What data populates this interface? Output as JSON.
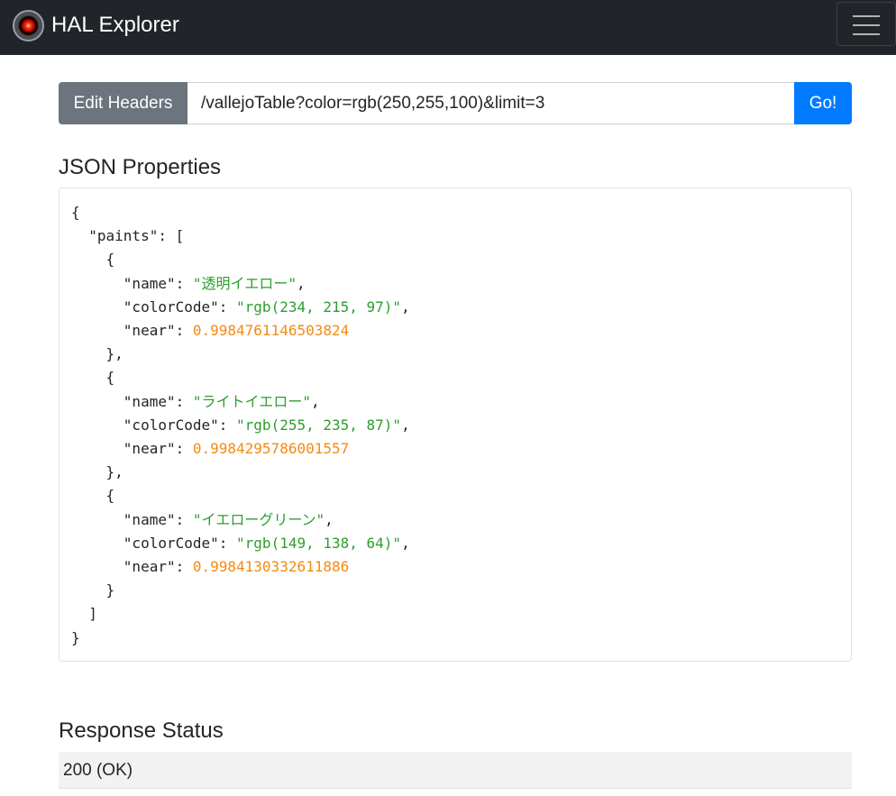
{
  "navbar": {
    "brand": "HAL Explorer",
    "logo_icon": "hal-eye-icon",
    "menu_icon": "hamburger-menu-icon"
  },
  "request": {
    "edit_headers_label": "Edit Headers",
    "uri_value": "/vallejoTable?color=rgb(250,255,100)&limit=3",
    "go_label": "Go!"
  },
  "json_section": {
    "title": "JSON Properties",
    "array_key": "\"paints\"",
    "items": [
      {
        "name": "\"透明イエロー\"",
        "colorCode": "\"rgb(234, 215, 97)\"",
        "near": "0.9984761146503824"
      },
      {
        "name": "\"ライトイエロー\"",
        "colorCode": "\"rgb(255, 235, 87)\"",
        "near": "0.9984295786001557"
      },
      {
        "name": "\"イエローグリーン\"",
        "colorCode": "\"rgb(149, 138, 64)\"",
        "near": "0.9984130332611886"
      }
    ],
    "keys": {
      "name": "\"name\"",
      "colorCode": "\"colorCode\"",
      "near": "\"near\""
    }
  },
  "status_section": {
    "title": "Response Status",
    "value": "200 (OK)"
  },
  "colors": {
    "navbar_bg": "#212529",
    "secondary_button": "#6c757d",
    "primary_button": "#007bff",
    "json_string": "#2e9e2e",
    "json_number": "#f38a12",
    "status_bg": "#f2f2f2"
  }
}
